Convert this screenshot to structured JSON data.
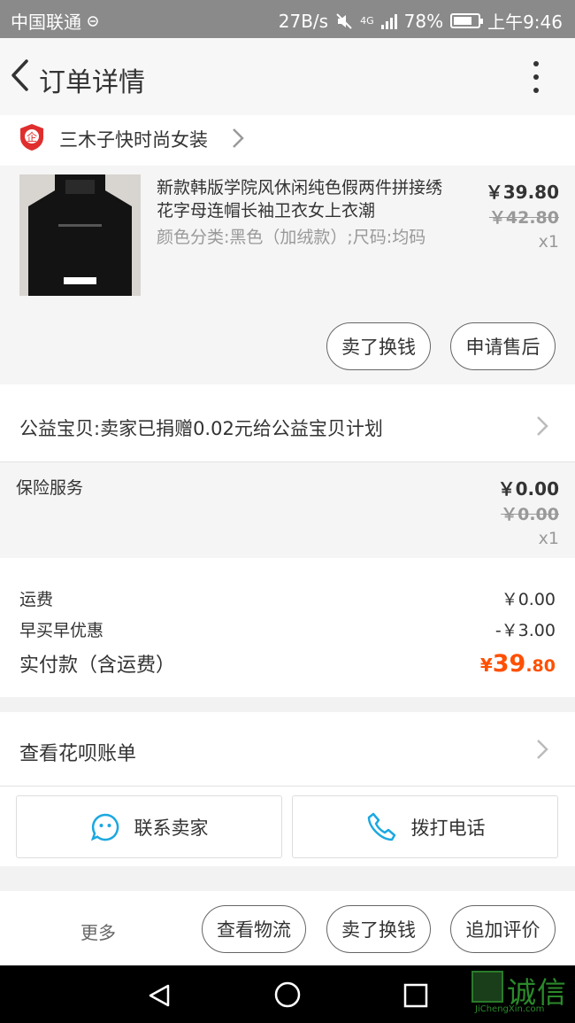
{
  "status_bar": {
    "carrier": "中国联通",
    "speed": "27B/s",
    "network": "4G",
    "battery": "78%",
    "battery_level": 0.78,
    "time": "上午9:46"
  },
  "header": {
    "title": "订单详情"
  },
  "shop": {
    "name": "三木子快时尚女装",
    "badge_char": "企"
  },
  "item": {
    "title": "新款韩版学院风休闲纯色假两件拼接绣花字母连帽长袖卫衣女上衣潮",
    "sku": "颜色分类:黑色（加绒款）;尺码:均码",
    "price": "￥39.80",
    "original_price": "￥42.80",
    "quantity": "x1",
    "sell_button": "卖了换钱",
    "after_sale_button": "申请售后"
  },
  "charity": {
    "text": "公益宝贝:卖家已捐赠0.02元给公益宝贝计划"
  },
  "insurance": {
    "label": "保险服务",
    "price": "￥0.00",
    "original_price": "￥0.00",
    "quantity": "x1"
  },
  "summary": {
    "shipping_label": "运费",
    "shipping_value": "￥0.00",
    "discount_label": "早买早优惠",
    "discount_value": "-￥3.00",
    "total_label": "实付款（含运费）",
    "total_currency": "¥",
    "total_integer": "39",
    "total_decimal": ".80"
  },
  "huabei": {
    "text": "查看花呗账单"
  },
  "contact": {
    "seller_label": "联系卖家",
    "phone_label": "拨打电话"
  },
  "actions": {
    "more": "更多",
    "logistics": "查看物流",
    "sell": "卖了换钱",
    "review": "追加评价"
  },
  "watermark": {
    "cn": "诚信",
    "en": "JiChengXin.com"
  },
  "colors": {
    "accent": "#ff5000",
    "status_bar": "#8a8a8a",
    "icon_blue": "#1ba8e0",
    "badge_red": "#e02e2e"
  }
}
